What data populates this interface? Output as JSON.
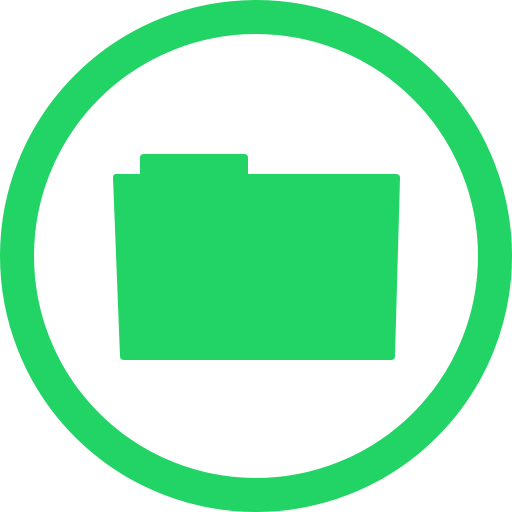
{
  "icon": {
    "name": "folder-in-circle-icon",
    "color": "#22d465",
    "background": "#ffffff"
  }
}
